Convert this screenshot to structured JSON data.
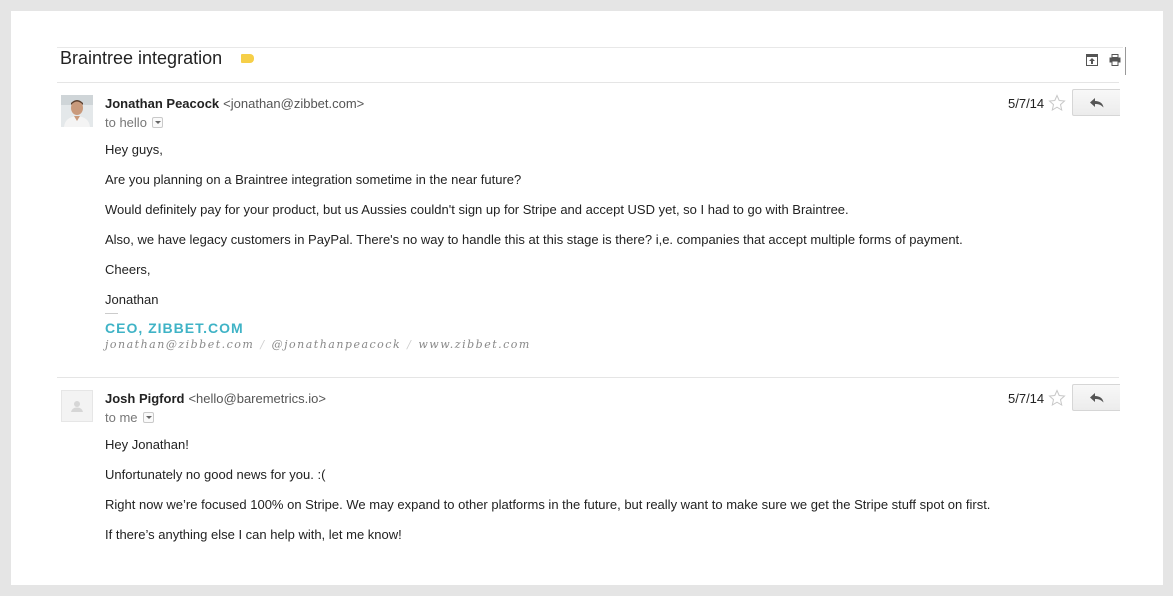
{
  "thread": {
    "subject": "Braintree integration",
    "label_color": "#f6cf48",
    "toolbar": {
      "archive_icon": "archive-icon",
      "print_icon": "print-icon"
    }
  },
  "messages": [
    {
      "sender_name": "Jonathan Peacock",
      "sender_email": "<jonathan@zibbet.com>",
      "recipient": "to hello",
      "date": "5/7/14",
      "avatar": "photo",
      "body": [
        "Hey guys,",
        "Are you planning on a Braintree integration sometime in the near future?",
        "Would definitely pay for your product, but us Aussies couldn't sign up for Stripe and accept USD yet, so I had to go with Braintree.",
        "Also, we have legacy customers in PayPal. There's no way to handle this at this stage is there? i,e. companies that accept multiple forms of payment.",
        "Cheers,",
        "Jonathan"
      ],
      "signature": {
        "title": "CEO, ZIBBET.COM",
        "title_color": "#3fb3c6",
        "email": "jonathan@zibbet.com",
        "twitter": "@jonathanpeacock",
        "website": "www.zibbet.com",
        "separator": "/"
      }
    },
    {
      "sender_name": "Josh Pigford",
      "sender_email": "<hello@baremetrics.io>",
      "recipient": "to me",
      "date": "5/7/14",
      "avatar": "default",
      "body": [
        "Hey Jonathan!",
        "Unfortunately no good news for you. :(",
        "Right now we’re focused 100% on Stripe. We may expand to other platforms in the future, but really want to make sure we get the Stripe stuff spot on first.",
        "If there’s anything else I can help with, let me know!"
      ]
    }
  ]
}
